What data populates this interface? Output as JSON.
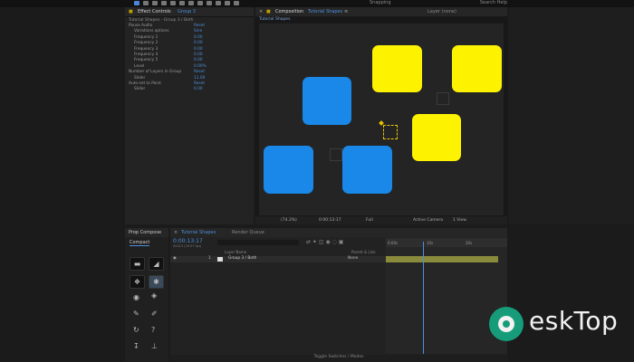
{
  "app": {
    "search_help": "Search Help",
    "snapping": "Snapping"
  },
  "effect_controls": {
    "tab_label": "Effect Controls",
    "tab_target": "Group 3",
    "breadcrumb": "Tutorial Shapes · Group 3 / Both",
    "rows": [
      {
        "label": "Pause Audio",
        "value": "Reset"
      },
      {
        "label": "Variations options",
        "value": "Sine"
      },
      {
        "label": "Frequency 1",
        "value": "0.00"
      },
      {
        "label": "Frequency 2",
        "value": "0.00"
      },
      {
        "label": "Frequency 3",
        "value": "0.00"
      },
      {
        "label": "Frequency 4",
        "value": "0.00"
      },
      {
        "label": "Frequency 5",
        "value": "0.00"
      },
      {
        "label": "Level",
        "value": "0.00%"
      },
      {
        "label": "Number of Layers in Group",
        "value": "Reset"
      },
      {
        "label": "Slider",
        "value": "11.00"
      },
      {
        "label": "Auto-set to Point",
        "value": "Reset"
      },
      {
        "label": "Slider",
        "value": "0.00"
      }
    ]
  },
  "composition": {
    "tab_label": "Composition",
    "tab_name": "Tutorial Shapes",
    "layer_tab": "Layer (none)",
    "breadcrumb": "Tutorial Shapes",
    "zoom": "(74.3%)",
    "timecode": "0:00:13:17",
    "resolution": "Full",
    "camera": "Active Camera",
    "views": "1 View"
  },
  "tools_panel": {
    "tab_label": "Prop Compose",
    "compact_label": "Compact",
    "help_glyph": "?"
  },
  "timeline": {
    "tab_label": "Tutorial Shapes",
    "render_queue": "Render Queue",
    "timecode": "0:00:13:17",
    "sub_timecode": "00413 (29.97 fps)",
    "columns": {
      "layer_name": "Layer Name",
      "parent": "Parent & Link"
    },
    "layer": {
      "index": "1",
      "name": "Group 3 / Both",
      "parent": "None"
    },
    "ruler_labels": [
      "0:00s",
      "10s",
      "20s"
    ],
    "toggle_label": "Toggle Switches / Modes"
  },
  "logo": {
    "text": "eskTop"
  }
}
